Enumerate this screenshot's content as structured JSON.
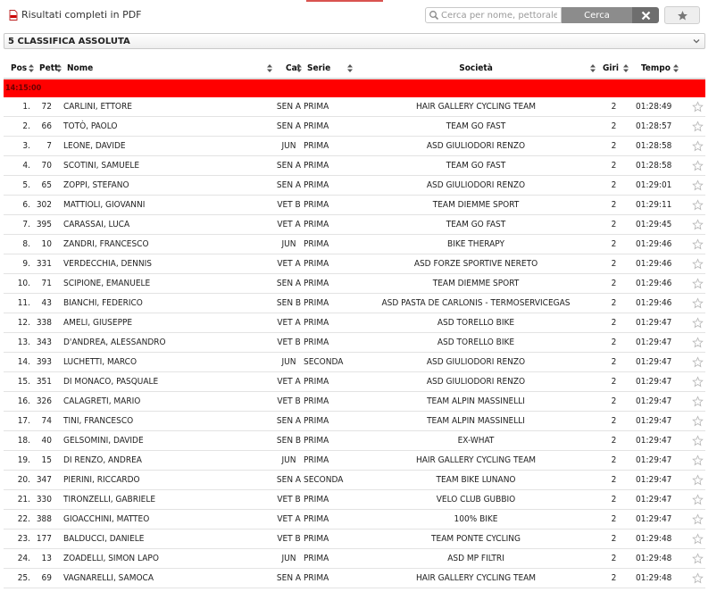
{
  "toolbar": {
    "pdf_label": "Risultati completi in PDF",
    "search_placeholder": "Cerca per nome, pettorale, società",
    "search_value": "",
    "search_button": "Cerca"
  },
  "classifica": {
    "selected": "5 CLASSIFICA ASSOLUTA"
  },
  "table": {
    "headers": {
      "pos": "Pos",
      "pett": "Pett",
      "nome": "Nome",
      "cat": "Cat",
      "serie": "Serie",
      "societa": "Società",
      "giri": "Giri",
      "tempo": "Tempo"
    },
    "group_time": "14:15:00",
    "rows": [
      {
        "pos": "1.",
        "pett": "72",
        "nome": "CARLINI, ETTORE",
        "cat": "SEN A",
        "serie": "PRIMA",
        "societa": "HAIR GALLERY CYCLING TEAM",
        "giri": "2",
        "tempo": "01:28:49"
      },
      {
        "pos": "2.",
        "pett": "66",
        "nome": "TOTÒ, PAOLO",
        "cat": "SEN A",
        "serie": "PRIMA",
        "societa": "TEAM GO FAST",
        "giri": "2",
        "tempo": "01:28:57"
      },
      {
        "pos": "3.",
        "pett": "7",
        "nome": "LEONE, DAVIDE",
        "cat": "JUN",
        "serie": "PRIMA",
        "societa": "ASD GIULIODORI RENZO",
        "giri": "2",
        "tempo": "01:28:58"
      },
      {
        "pos": "4.",
        "pett": "70",
        "nome": "SCOTINI, SAMUELE",
        "cat": "SEN A",
        "serie": "PRIMA",
        "societa": "TEAM GO FAST",
        "giri": "2",
        "tempo": "01:28:58"
      },
      {
        "pos": "5.",
        "pett": "65",
        "nome": "ZOPPI, STEFANO",
        "cat": "SEN A",
        "serie": "PRIMA",
        "societa": "ASD GIULIODORI RENZO",
        "giri": "2",
        "tempo": "01:29:01"
      },
      {
        "pos": "6.",
        "pett": "302",
        "nome": "MATTIOLI, GIOVANNI",
        "cat": "VET B",
        "serie": "PRIMA",
        "societa": "TEAM DIEMME SPORT",
        "giri": "2",
        "tempo": "01:29:11"
      },
      {
        "pos": "7.",
        "pett": "395",
        "nome": "CARASSAI, LUCA",
        "cat": "VET A",
        "serie": "PRIMA",
        "societa": "TEAM GO FAST",
        "giri": "2",
        "tempo": "01:29:45"
      },
      {
        "pos": "8.",
        "pett": "10",
        "nome": "ZANDRI, FRANCESCO",
        "cat": "JUN",
        "serie": "PRIMA",
        "societa": "BIKE THERAPY",
        "giri": "2",
        "tempo": "01:29:46"
      },
      {
        "pos": "9.",
        "pett": "331",
        "nome": "VERDECCHIA, DENNIS",
        "cat": "VET A",
        "serie": "PRIMA",
        "societa": "ASD FORZE SPORTIVE NERETO",
        "giri": "2",
        "tempo": "01:29:46"
      },
      {
        "pos": "10.",
        "pett": "71",
        "nome": "SCIPIONE, EMANUELE",
        "cat": "SEN A",
        "serie": "PRIMA",
        "societa": "TEAM DIEMME SPORT",
        "giri": "2",
        "tempo": "01:29:46"
      },
      {
        "pos": "11.",
        "pett": "43",
        "nome": "BIANCHI, FEDERICO",
        "cat": "SEN B",
        "serie": "PRIMA",
        "societa": "ASD PASTA DE CARLONIS - TERMOSERVICEGAS",
        "giri": "2",
        "tempo": "01:29:46"
      },
      {
        "pos": "12.",
        "pett": "338",
        "nome": "AMELI, GIUSEPPE",
        "cat": "VET A",
        "serie": "PRIMA",
        "societa": "ASD TORELLO BIKE",
        "giri": "2",
        "tempo": "01:29:47"
      },
      {
        "pos": "13.",
        "pett": "343",
        "nome": "D'ANDREA, ALESSANDRO",
        "cat": "VET B",
        "serie": "PRIMA",
        "societa": "ASD TORELLO BIKE",
        "giri": "2",
        "tempo": "01:29:47"
      },
      {
        "pos": "14.",
        "pett": "393",
        "nome": "LUCHETTI, MARCO",
        "cat": "JUN",
        "serie": "SECONDA",
        "societa": "ASD GIULIODORI RENZO",
        "giri": "2",
        "tempo": "01:29:47"
      },
      {
        "pos": "15.",
        "pett": "351",
        "nome": "DI MONACO, PASQUALE",
        "cat": "VET A",
        "serie": "PRIMA",
        "societa": "ASD GIULIODORI RENZO",
        "giri": "2",
        "tempo": "01:29:47"
      },
      {
        "pos": "16.",
        "pett": "326",
        "nome": "CALAGRETI, MARIO",
        "cat": "VET B",
        "serie": "PRIMA",
        "societa": "TEAM ALPIN MASSINELLI",
        "giri": "2",
        "tempo": "01:29:47"
      },
      {
        "pos": "17.",
        "pett": "74",
        "nome": "TINI, FRANCESCO",
        "cat": "SEN A",
        "serie": "PRIMA",
        "societa": "TEAM ALPIN MASSINELLI",
        "giri": "2",
        "tempo": "01:29:47"
      },
      {
        "pos": "18.",
        "pett": "40",
        "nome": "GELSOMINI, DAVIDE",
        "cat": "SEN B",
        "serie": "PRIMA",
        "societa": "EX-WHAT",
        "giri": "2",
        "tempo": "01:29:47"
      },
      {
        "pos": "19.",
        "pett": "15",
        "nome": "DI RENZO, ANDREA",
        "cat": "JUN",
        "serie": "PRIMA",
        "societa": "HAIR GALLERY CYCLING TEAM",
        "giri": "2",
        "tempo": "01:29:47"
      },
      {
        "pos": "20.",
        "pett": "347",
        "nome": "PIERINI, RICCARDO",
        "cat": "SEN A",
        "serie": "SECONDA",
        "societa": "TEAM BIKE LUNANO",
        "giri": "2",
        "tempo": "01:29:47"
      },
      {
        "pos": "21.",
        "pett": "330",
        "nome": "TIRONZELLI, GABRIELE",
        "cat": "VET B",
        "serie": "PRIMA",
        "societa": "VELO CLUB GUBBIO",
        "giri": "2",
        "tempo": "01:29:47"
      },
      {
        "pos": "22.",
        "pett": "388",
        "nome": "GIOACCHINI, MATTEO",
        "cat": "VET A",
        "serie": "PRIMA",
        "societa": "100% BIKE",
        "giri": "2",
        "tempo": "01:29:47"
      },
      {
        "pos": "23.",
        "pett": "177",
        "nome": "BALDUCCI, DANIELE",
        "cat": "VET B",
        "serie": "PRIMA",
        "societa": "TEAM PONTE CYCLING",
        "giri": "2",
        "tempo": "01:29:48"
      },
      {
        "pos": "24.",
        "pett": "13",
        "nome": "ZOADELLI, SIMON LAPO",
        "cat": "JUN",
        "serie": "PRIMA",
        "societa": "ASD MP FILTRI",
        "giri": "2",
        "tempo": "01:29:48"
      },
      {
        "pos": "25.",
        "pett": "69",
        "nome": "VAGNARELLI, SAMOCA",
        "cat": "SEN A",
        "serie": "PRIMA",
        "societa": "HAIR GALLERY CYCLING TEAM",
        "giri": "2",
        "tempo": "01:29:48"
      }
    ]
  }
}
